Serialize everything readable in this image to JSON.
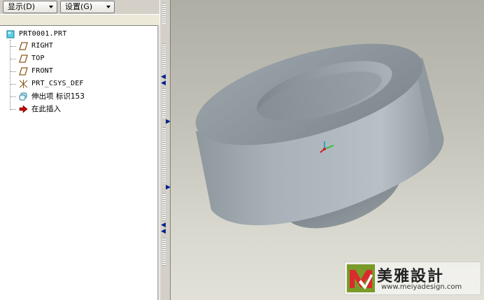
{
  "toolbar": {
    "display_label": "显示(D)",
    "settings_label": "设置(G)"
  },
  "tree": {
    "root": "PRT0001.PRT",
    "items": [
      {
        "label": "RIGHT",
        "icon": "datum-plane-icon"
      },
      {
        "label": "TOP",
        "icon": "datum-plane-icon"
      },
      {
        "label": "FRONT",
        "icon": "datum-plane-icon"
      },
      {
        "label": "PRT_CSYS_DEF",
        "icon": "coordinate-system-icon"
      },
      {
        "label": "伸出项 标识153",
        "icon": "extrude-feature-icon"
      },
      {
        "label": "在此插入",
        "icon": "insert-here-arrow-icon"
      }
    ]
  },
  "colors": {
    "panel_bg": "#d4d0c8",
    "tree_bg": "#ffffff",
    "datum_plane": "#8a5a1a",
    "insert_arrow": "#c00000",
    "model_gray": "#9aa6ae"
  },
  "watermark": {
    "title": "美雅設計",
    "url": "www.meiyadesign.com"
  }
}
